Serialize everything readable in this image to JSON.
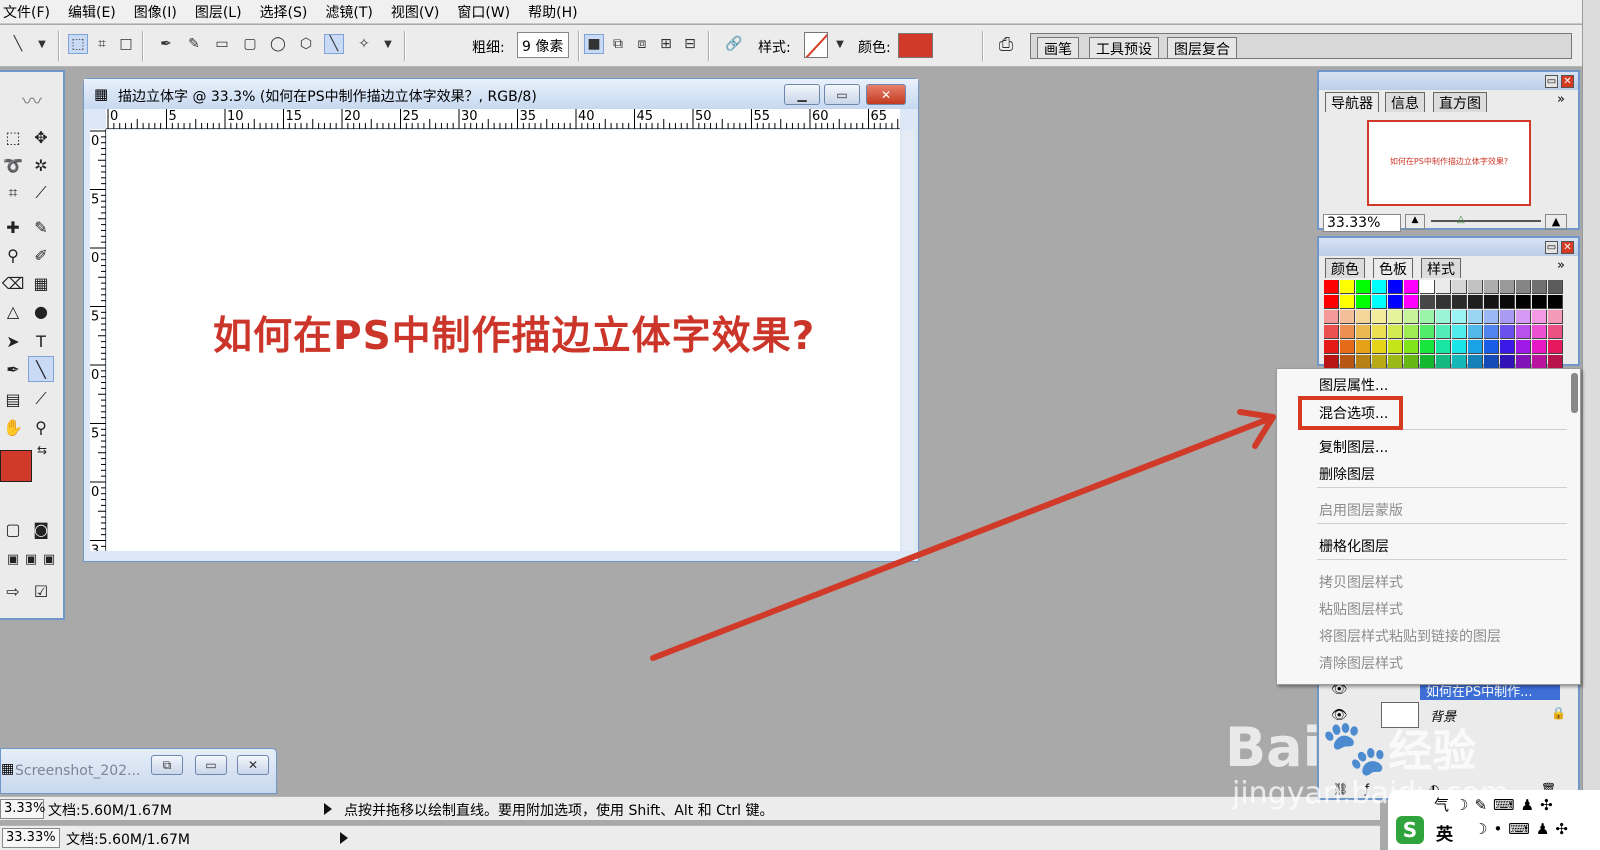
{
  "menu": [
    "文件(F)",
    "编辑(E)",
    "图像(I)",
    "图层(L)",
    "选择(S)",
    "滤镜(T)",
    "视图(V)",
    "窗口(W)",
    "帮助(H)"
  ],
  "options": {
    "weight_label": "粗细:",
    "weight_value": "9 像素",
    "style_label": "样式:",
    "color_label": "颜色:",
    "stroke_color": "#d13a28",
    "wells": [
      "画笔",
      "工具预设",
      "图层复合"
    ]
  },
  "document": {
    "title": "描边立体字 @ 33.3% (如何在PS中制作描边立体字效果？, RGB/8)",
    "canvas_text": "如何在PS中制作描边立体字效果?",
    "canvas_text_color": "#cc3529",
    "h_ruler_labels": [
      "0",
      "5",
      "10",
      "15",
      "20",
      "25",
      "30",
      "35",
      "40",
      "45",
      "50",
      "55",
      "60",
      "65"
    ],
    "v_ruler_labels": [
      "0",
      "5",
      "0",
      "5",
      "0",
      "5",
      "0",
      "3"
    ]
  },
  "minimized_window": {
    "title": "Screenshot_202..."
  },
  "status_bar_1": {
    "zoom": "3.33%",
    "doc": "文档:5.60M/1.67M",
    "hint": "点按并拖移以绘制直线。要用附加选项，使用 Shift、Alt 和 Ctrl 键。"
  },
  "status_bar_2": {
    "zoom": "33.33%",
    "doc": "文档:5.60M/1.67M"
  },
  "navigator_panel": {
    "tabs": [
      "导航器",
      "信息",
      "直方图"
    ],
    "thumb_text": "如何在PS中制作描边立体字效果?",
    "zoom": "33.33%"
  },
  "swatches_panel": {
    "tabs": [
      "颜色",
      "色板",
      "样式"
    ]
  },
  "context_menu": {
    "items": [
      {
        "label": "图层属性...",
        "enabled": true
      },
      {
        "label": "混合选项...",
        "enabled": true,
        "highlighted": true
      },
      {
        "label": "复制图层...",
        "enabled": true
      },
      {
        "label": "删除图层",
        "enabled": true
      },
      {
        "label": "启用图层蒙版",
        "enabled": false
      },
      {
        "label": "栅格化图层",
        "enabled": true
      },
      {
        "label": "拷贝图层样式",
        "enabled": false
      },
      {
        "label": "粘贴图层样式",
        "enabled": false
      },
      {
        "label": "将图层样式粘贴到链接的图层",
        "enabled": false
      },
      {
        "label": "清除图层样式",
        "enabled": false
      }
    ]
  },
  "layers_panel": {
    "layer_text": "如何在PS中制作...",
    "layer_bg": "背景"
  },
  "watermark": {
    "brand": "Bai",
    "brand_suffix": "经验",
    "url": "jingyan.baidu.com"
  },
  "ime": {
    "logo": "S",
    "mode": "英"
  },
  "colors": {
    "accent": "#6f97c9",
    "highlight_red": "#d63b22"
  }
}
